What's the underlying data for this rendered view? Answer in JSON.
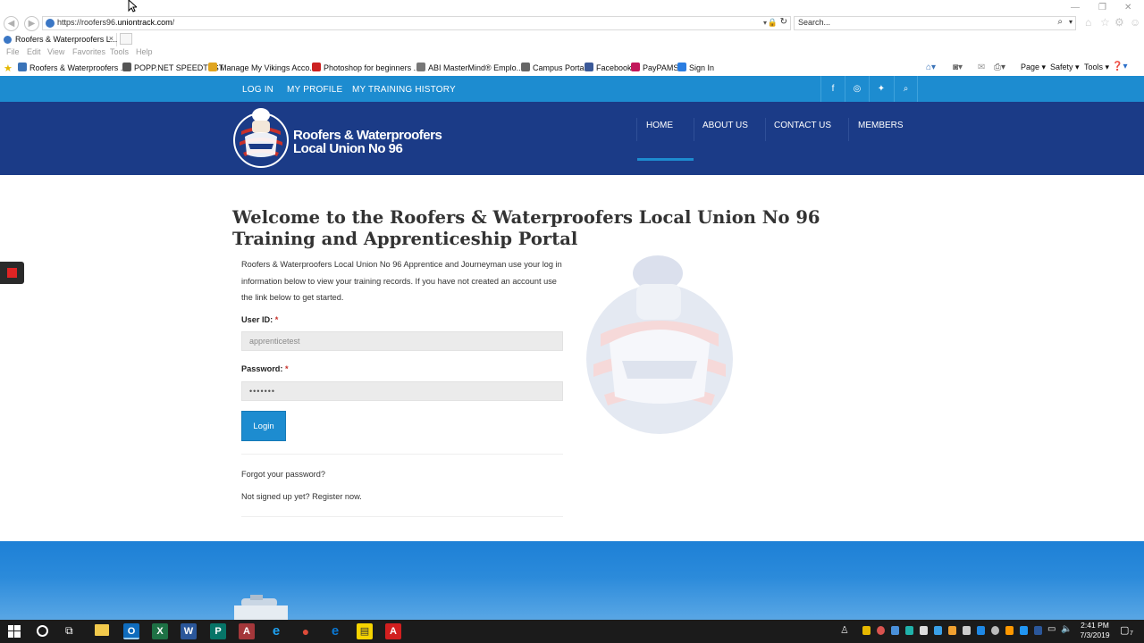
{
  "browser": {
    "url_prefix": "https://roofers96.",
    "url_domain": "uniontrack.com",
    "url_suffix": "/",
    "search_placeholder": "Search...",
    "tab_title": "Roofers & Waterproofers L...",
    "tab_close": "×",
    "menu": [
      "File",
      "Edit",
      "View",
      "Favorites",
      "Tools",
      "Help"
    ],
    "favorites": [
      {
        "label": "Roofers & Waterproofers ...",
        "color": "#3a73b8"
      },
      {
        "label": "POPP.NET SPEEDTEST",
        "color": "#555555"
      },
      {
        "label": "Manage My Vikings Acco...",
        "color": "#e0a521"
      },
      {
        "label": "Photoshop for beginners ...",
        "color": "#cc2222"
      },
      {
        "label": "ABI MasterMind® Emplo...",
        "color": "#777777"
      },
      {
        "label": "Campus Portal",
        "color": "#666666"
      },
      {
        "label": "Facebook",
        "color": "#3b5998"
      },
      {
        "label": "PayPAMS",
        "color": "#c2185b"
      },
      {
        "label": "Sign In",
        "color": "#2a7de1"
      }
    ],
    "commands": {
      "page": "Page ▾",
      "safety": "Safety ▾",
      "tools": "Tools ▾"
    }
  },
  "topbar": {
    "links": [
      "LOG IN",
      "MY PROFILE",
      "MY TRAINING HISTORY"
    ],
    "social_icons": [
      "facebook-icon",
      "instagram-icon",
      "twitter-icon",
      "search-icon"
    ],
    "social_glyphs": [
      "f",
      "◎",
      "✦",
      "⌕"
    ]
  },
  "header": {
    "logo_line1": "Roofers & Waterproofers",
    "logo_line2": "Local Union No 96",
    "nav": [
      "HOME",
      "ABOUT US",
      "CONTACT US",
      "MEMBERS"
    ],
    "active_nav": "HOME"
  },
  "main": {
    "title": "Welcome to the Roofers & Waterproofers Local Union No 96 Training and Apprenticeship Portal",
    "intro": "Roofers & Waterproofers Local Union No 96 Apprentice and Journeyman use your log in information below to view your training records. If you have not created an account use the link below to get started.",
    "userid_label": "User ID:",
    "userid_value": "apprenticetest",
    "password_label": "Password:",
    "password_value": "•••••••",
    "required_mark": "*",
    "login_button": "Login",
    "forgot_link": "Forgot your password?",
    "register_link": "Not signed up yet? Register now."
  },
  "taskbar": {
    "time": "2:41 PM",
    "date": "7/3/2019",
    "notification_count": "7",
    "apps": [
      {
        "name": "outlook-icon",
        "glyph": "O",
        "color": "#0f6cbd"
      },
      {
        "name": "excel-icon",
        "glyph": "X",
        "color": "#1e7145"
      },
      {
        "name": "word-icon",
        "glyph": "W",
        "color": "#2b579a"
      },
      {
        "name": "publisher-icon",
        "glyph": "P",
        "color": "#077568"
      },
      {
        "name": "access-icon",
        "glyph": "A",
        "color": "#a4373a"
      },
      {
        "name": "internet-explorer-icon",
        "glyph": "e",
        "color": "#1ea1f1"
      },
      {
        "name": "chrome-icon",
        "glyph": "●",
        "color": "#dd4b39"
      },
      {
        "name": "edge-icon",
        "glyph": "e",
        "color": "#0a78d4"
      },
      {
        "name": "sticky-notes-icon",
        "glyph": "▤",
        "color": "#f5d300"
      },
      {
        "name": "acrobat-icon",
        "glyph": "A",
        "color": "#d21f1f"
      }
    ]
  }
}
